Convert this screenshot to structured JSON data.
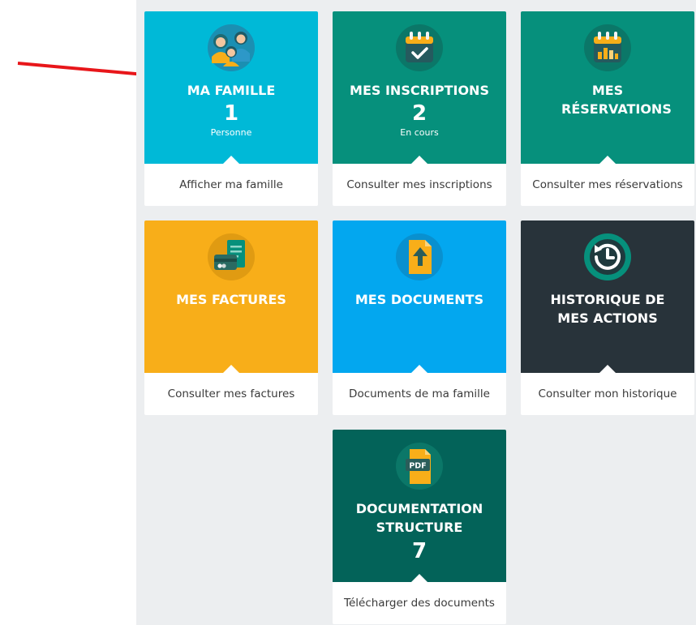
{
  "colors": {
    "cyan": "#00b9d7",
    "teal": "#06907c",
    "amber": "#f8ae19",
    "sky": "#03a7ef",
    "dark": "#28333a",
    "deepteal": "#036359",
    "arrow": "#e8161a"
  },
  "tiles": [
    {
      "title": "MA FAMILLE",
      "count": "1",
      "sub": "Personne",
      "link": "Afficher ma famille",
      "icon": "family-icon"
    },
    {
      "title": "MES INSCRIPTIONS",
      "count": "2",
      "sub": "En cours",
      "link": "Consulter mes inscriptions",
      "icon": "calendar-check-icon"
    },
    {
      "title": "MES RÉSERVATIONS",
      "link": "Consulter mes réservations",
      "icon": "calendar-chart-icon"
    },
    {
      "title": "MES FACTURES",
      "link": "Consulter mes factures",
      "icon": "invoice-card-icon"
    },
    {
      "title": "MES DOCUMENTS",
      "link": "Documents de ma famille",
      "icon": "document-upload-icon"
    },
    {
      "title": "HISTORIQUE DE MES ACTIONS",
      "link": "Consulter mon historique",
      "icon": "history-icon"
    },
    {
      "title": "DOCUMENTATION STRUCTURE",
      "count": "7",
      "link": "Télécharger des documents",
      "icon": "pdf-icon",
      "icon_text": "PDF"
    }
  ]
}
